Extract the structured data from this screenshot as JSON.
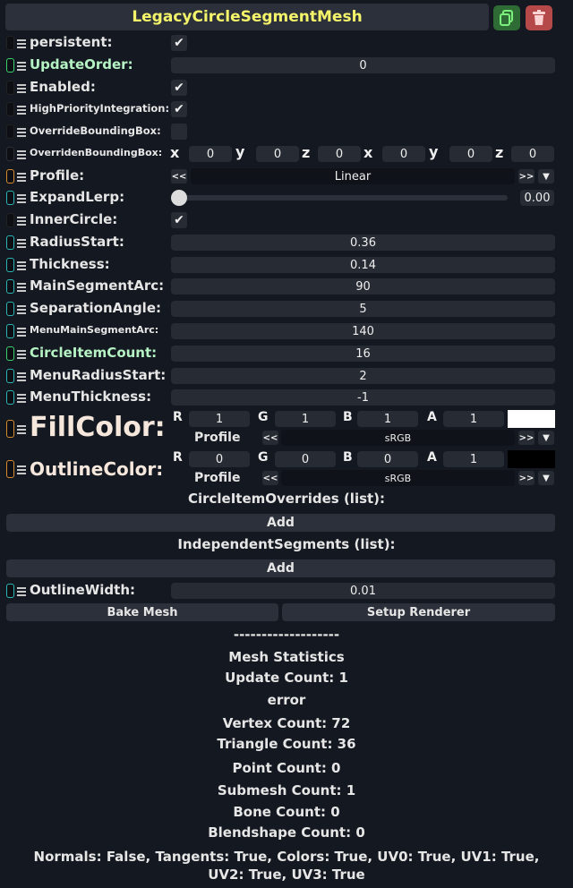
{
  "title": "LegacyCircleSegmentMesh",
  "header_icons": {
    "duplicate": "copy-icon",
    "delete": "trash-icon"
  },
  "fields": {
    "persistent": {
      "label": "persistent:",
      "checked": true
    },
    "update_order": {
      "label": "UpdateOrder:",
      "value": "0"
    },
    "enabled": {
      "label": "Enabled:",
      "checked": true
    },
    "high_priority": {
      "label": "HighPriorityIntegration:",
      "checked": true
    },
    "override_bbox": {
      "label": "OverrideBoundingBox:",
      "checked": false
    },
    "overriden_bbox": {
      "label": "OverridenBoundingBox:",
      "axes": [
        "x",
        "y",
        "z",
        "x",
        "y",
        "z"
      ],
      "values": [
        "0",
        "0",
        "0",
        "0",
        "0",
        "0"
      ]
    },
    "profile": {
      "label": "Profile:",
      "value": "Linear",
      "prev": "<<",
      "next": ">>"
    },
    "expand_lerp": {
      "label": "ExpandLerp:",
      "value": "0.00",
      "fraction": 0
    },
    "inner_circle": {
      "label": "InnerCircle:",
      "checked": true
    },
    "radius_start": {
      "label": "RadiusStart:",
      "value": "0.36"
    },
    "thickness": {
      "label": "Thickness:",
      "value": "0.14"
    },
    "main_segment_arc": {
      "label": "MainSegmentArc:",
      "value": "90"
    },
    "separation_angle": {
      "label": "SeparationAngle:",
      "value": "5"
    },
    "menu_main_segment_arc": {
      "label": "MenuMainSegmentArc:",
      "value": "140"
    },
    "circle_item_count": {
      "label": "CircleItemCount:",
      "value": "16"
    },
    "menu_radius_start": {
      "label": "MenuRadiusStart:",
      "value": "2"
    },
    "menu_thickness": {
      "label": "MenuThickness:",
      "value": "-1"
    },
    "fill_color": {
      "label": "FillColor:",
      "channels": [
        "R",
        "G",
        "B",
        "A"
      ],
      "values": [
        "1",
        "1",
        "1",
        "1"
      ],
      "swatch": "#ffffff",
      "profile_label": "Profile",
      "profile": "sRGB"
    },
    "outline_color": {
      "label": "OutlineColor:",
      "channels": [
        "R",
        "G",
        "B",
        "A"
      ],
      "values": [
        "0",
        "0",
        "0",
        "1"
      ],
      "swatch": "#000000",
      "profile_label": "Profile",
      "profile": "sRGB"
    },
    "outline_width": {
      "label": "OutlineWidth:",
      "value": "0.01"
    }
  },
  "lists": {
    "circle_item_overrides": {
      "title": "CircleItemOverrides (list):",
      "add": "Add"
    },
    "independent_segments": {
      "title": "IndependentSegments (list):",
      "add": "Add"
    }
  },
  "buttons": {
    "bake": "Bake Mesh",
    "setup": "Setup Renderer"
  },
  "stats": {
    "divider": "-------------------",
    "heading": "Mesh Statistics",
    "update_count": "Update Count: 1",
    "error": "error",
    "vertex_count": "Vertex Count: 72",
    "triangle_count": "Triangle Count: 36",
    "point_count": "Point Count: 0",
    "submesh_count": "Submesh Count: 1",
    "bone_count": "Bone Count: 0",
    "blendshape_count": "Blendshape Count: 0",
    "attributes": "Normals: False, Tangents: True, Colors: True, UV0: True, UV1: True, UV2: True, UV3: True"
  },
  "colors": {
    "title": "#f4f46a",
    "handle_green": "#3bd16f",
    "handle_teal": "#2cb3b3",
    "handle_orange": "#d38b2e",
    "handle_dark": "#2a2e36"
  }
}
